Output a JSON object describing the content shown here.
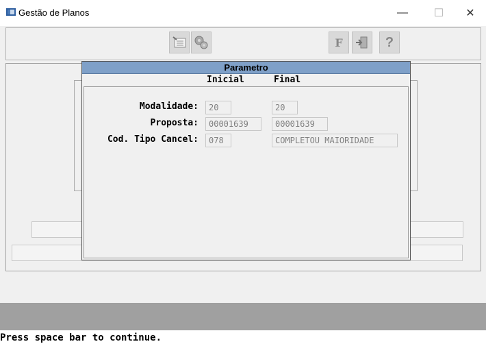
{
  "window": {
    "title": "Gestão de Planos",
    "minimize_glyph": "—",
    "maximize_glyph": "☐",
    "close_glyph": "✕"
  },
  "toolbar": {
    "icons": [
      "edit-list-icon",
      "settings-gears-icon",
      "f-key-icon",
      "exit-door-icon",
      "help-question-icon"
    ],
    "help_glyph": "?",
    "f_glyph": "F"
  },
  "dialog": {
    "title": "Parametro",
    "col_inicial": "Inicial",
    "col_final": "Final",
    "rows": [
      {
        "label": "Modalidade:",
        "inicial": "20",
        "final": "20"
      },
      {
        "label": "Proposta:",
        "inicial": "00001639",
        "final": "00001639"
      },
      {
        "label": "Cod. Tipo Cancel:",
        "inicial": "078",
        "final": "COMPLETOU MAIORIDADE"
      }
    ]
  },
  "status": {
    "message": "Press space bar to continue."
  }
}
